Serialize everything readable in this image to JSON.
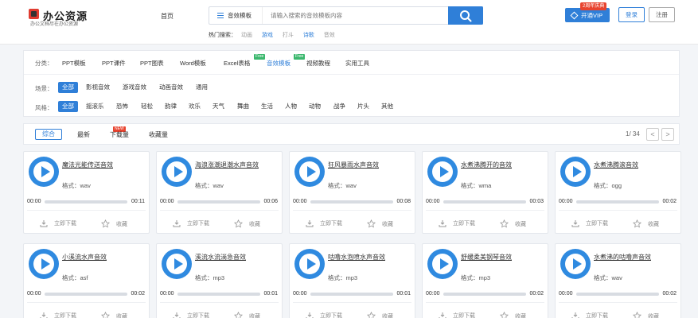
{
  "header": {
    "logo_title": "办公资源",
    "logo_subtitle": "办公文档尽在办公资源",
    "nav_home": "首页",
    "search_category": "音效模板",
    "search_placeholder": "请输入搜索的音效模板内容",
    "hot_label": "热门搜索：",
    "hot_searches": [
      "动画",
      "游戏",
      "打斗",
      "诗歌",
      "音效"
    ],
    "vip_label": "开通VIP",
    "vip_badge": "2周年庆典",
    "login_label": "登录",
    "register_label": "注册"
  },
  "filters": {
    "category_label": "分类：",
    "categories": [
      "PPT模板",
      "PPT课件",
      "PPT图表",
      "Word模板",
      "Excel表格",
      "音效模板",
      "视频教程",
      "实用工具"
    ],
    "free_tag": "Free",
    "scene_label": "场景：",
    "scenes": [
      "全部",
      "影视音效",
      "游戏音效",
      "动画音效",
      "通用"
    ],
    "style_label": "风格：",
    "styles": [
      "全部",
      "摇滚乐",
      "恐怖",
      "轻松",
      "韵律",
      "欢乐",
      "天气",
      "舞曲",
      "生活",
      "人物",
      "动物",
      "战争",
      "片头",
      "其他"
    ]
  },
  "sortbar": {
    "items": [
      "综合",
      "最新",
      "下载量",
      "收藏量"
    ],
    "new_tag": "NEW",
    "page_info": "1/ 34",
    "prev": "<",
    "next": ">"
  },
  "card_labels": {
    "format_prefix": "格式：",
    "download": "立即下载",
    "favorite": "收藏"
  },
  "cards": [
    {
      "title": "魔法光能传送音效",
      "format": "wav",
      "start": "00:00",
      "end": "00:11"
    },
    {
      "title": "海浪涨潮退潮水声音效",
      "format": "wav",
      "start": "00:00",
      "end": "00:06"
    },
    {
      "title": "狂风暴雨水声音效",
      "format": "wav",
      "start": "00:00",
      "end": "00:08"
    },
    {
      "title": "水煮沸腾开的音效",
      "format": "wma",
      "start": "00:00",
      "end": "00:03"
    },
    {
      "title": "水煮沸腾滚音效",
      "format": "ogg",
      "start": "00:00",
      "end": "00:02"
    },
    {
      "title": "小溪流水声音效",
      "format": "asf",
      "start": "00:00",
      "end": "00:02"
    },
    {
      "title": "溪流水流淌急音效",
      "format": "mp3",
      "start": "00:00",
      "end": "00:01"
    },
    {
      "title": "咕噜水泡喷水声音效",
      "format": "mp3",
      "start": "00:00",
      "end": "00:01"
    },
    {
      "title": "舒缓柔美钢琴音效",
      "format": "mp3",
      "start": "00:00",
      "end": "00:02"
    },
    {
      "title": "水煮沸的咕噜声音效",
      "format": "wav",
      "start": "00:00",
      "end": "00:02"
    }
  ],
  "colors": {
    "accent": "#2f7fd8",
    "free": "#3cb86e",
    "new": "#e8432f"
  }
}
